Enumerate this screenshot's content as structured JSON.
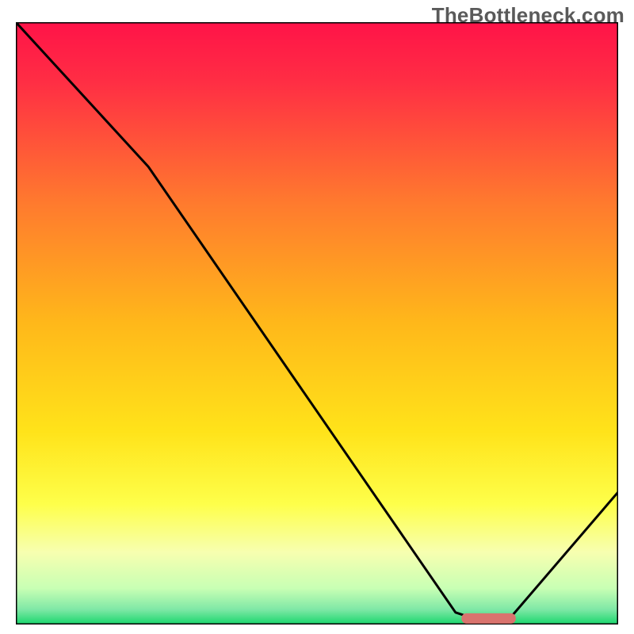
{
  "watermark": "TheBottleneck.com",
  "chart_data": {
    "type": "line",
    "title": "",
    "xlabel": "",
    "ylabel": "",
    "xlim": [
      0,
      100
    ],
    "ylim": [
      0,
      100
    ],
    "x": [
      0,
      22,
      73,
      76,
      82,
      100
    ],
    "values": [
      100,
      76,
      2,
      1,
      1,
      22
    ],
    "marker": {
      "x_start": 74,
      "x_end": 83,
      "y": 1
    },
    "background": {
      "type": "vertical-gradient",
      "stops": [
        {
          "pos": 0.0,
          "color": "#ff1348"
        },
        {
          "pos": 0.1,
          "color": "#ff2e44"
        },
        {
          "pos": 0.3,
          "color": "#ff7a2e"
        },
        {
          "pos": 0.5,
          "color": "#ffb81a"
        },
        {
          "pos": 0.68,
          "color": "#ffe31a"
        },
        {
          "pos": 0.8,
          "color": "#feff4a"
        },
        {
          "pos": 0.88,
          "color": "#f7ffb0"
        },
        {
          "pos": 0.94,
          "color": "#c8ffb4"
        },
        {
          "pos": 0.975,
          "color": "#7fe8a6"
        },
        {
          "pos": 1.0,
          "color": "#18d66c"
        }
      ]
    },
    "series_color": "#000000",
    "marker_color": "#d9736e"
  }
}
